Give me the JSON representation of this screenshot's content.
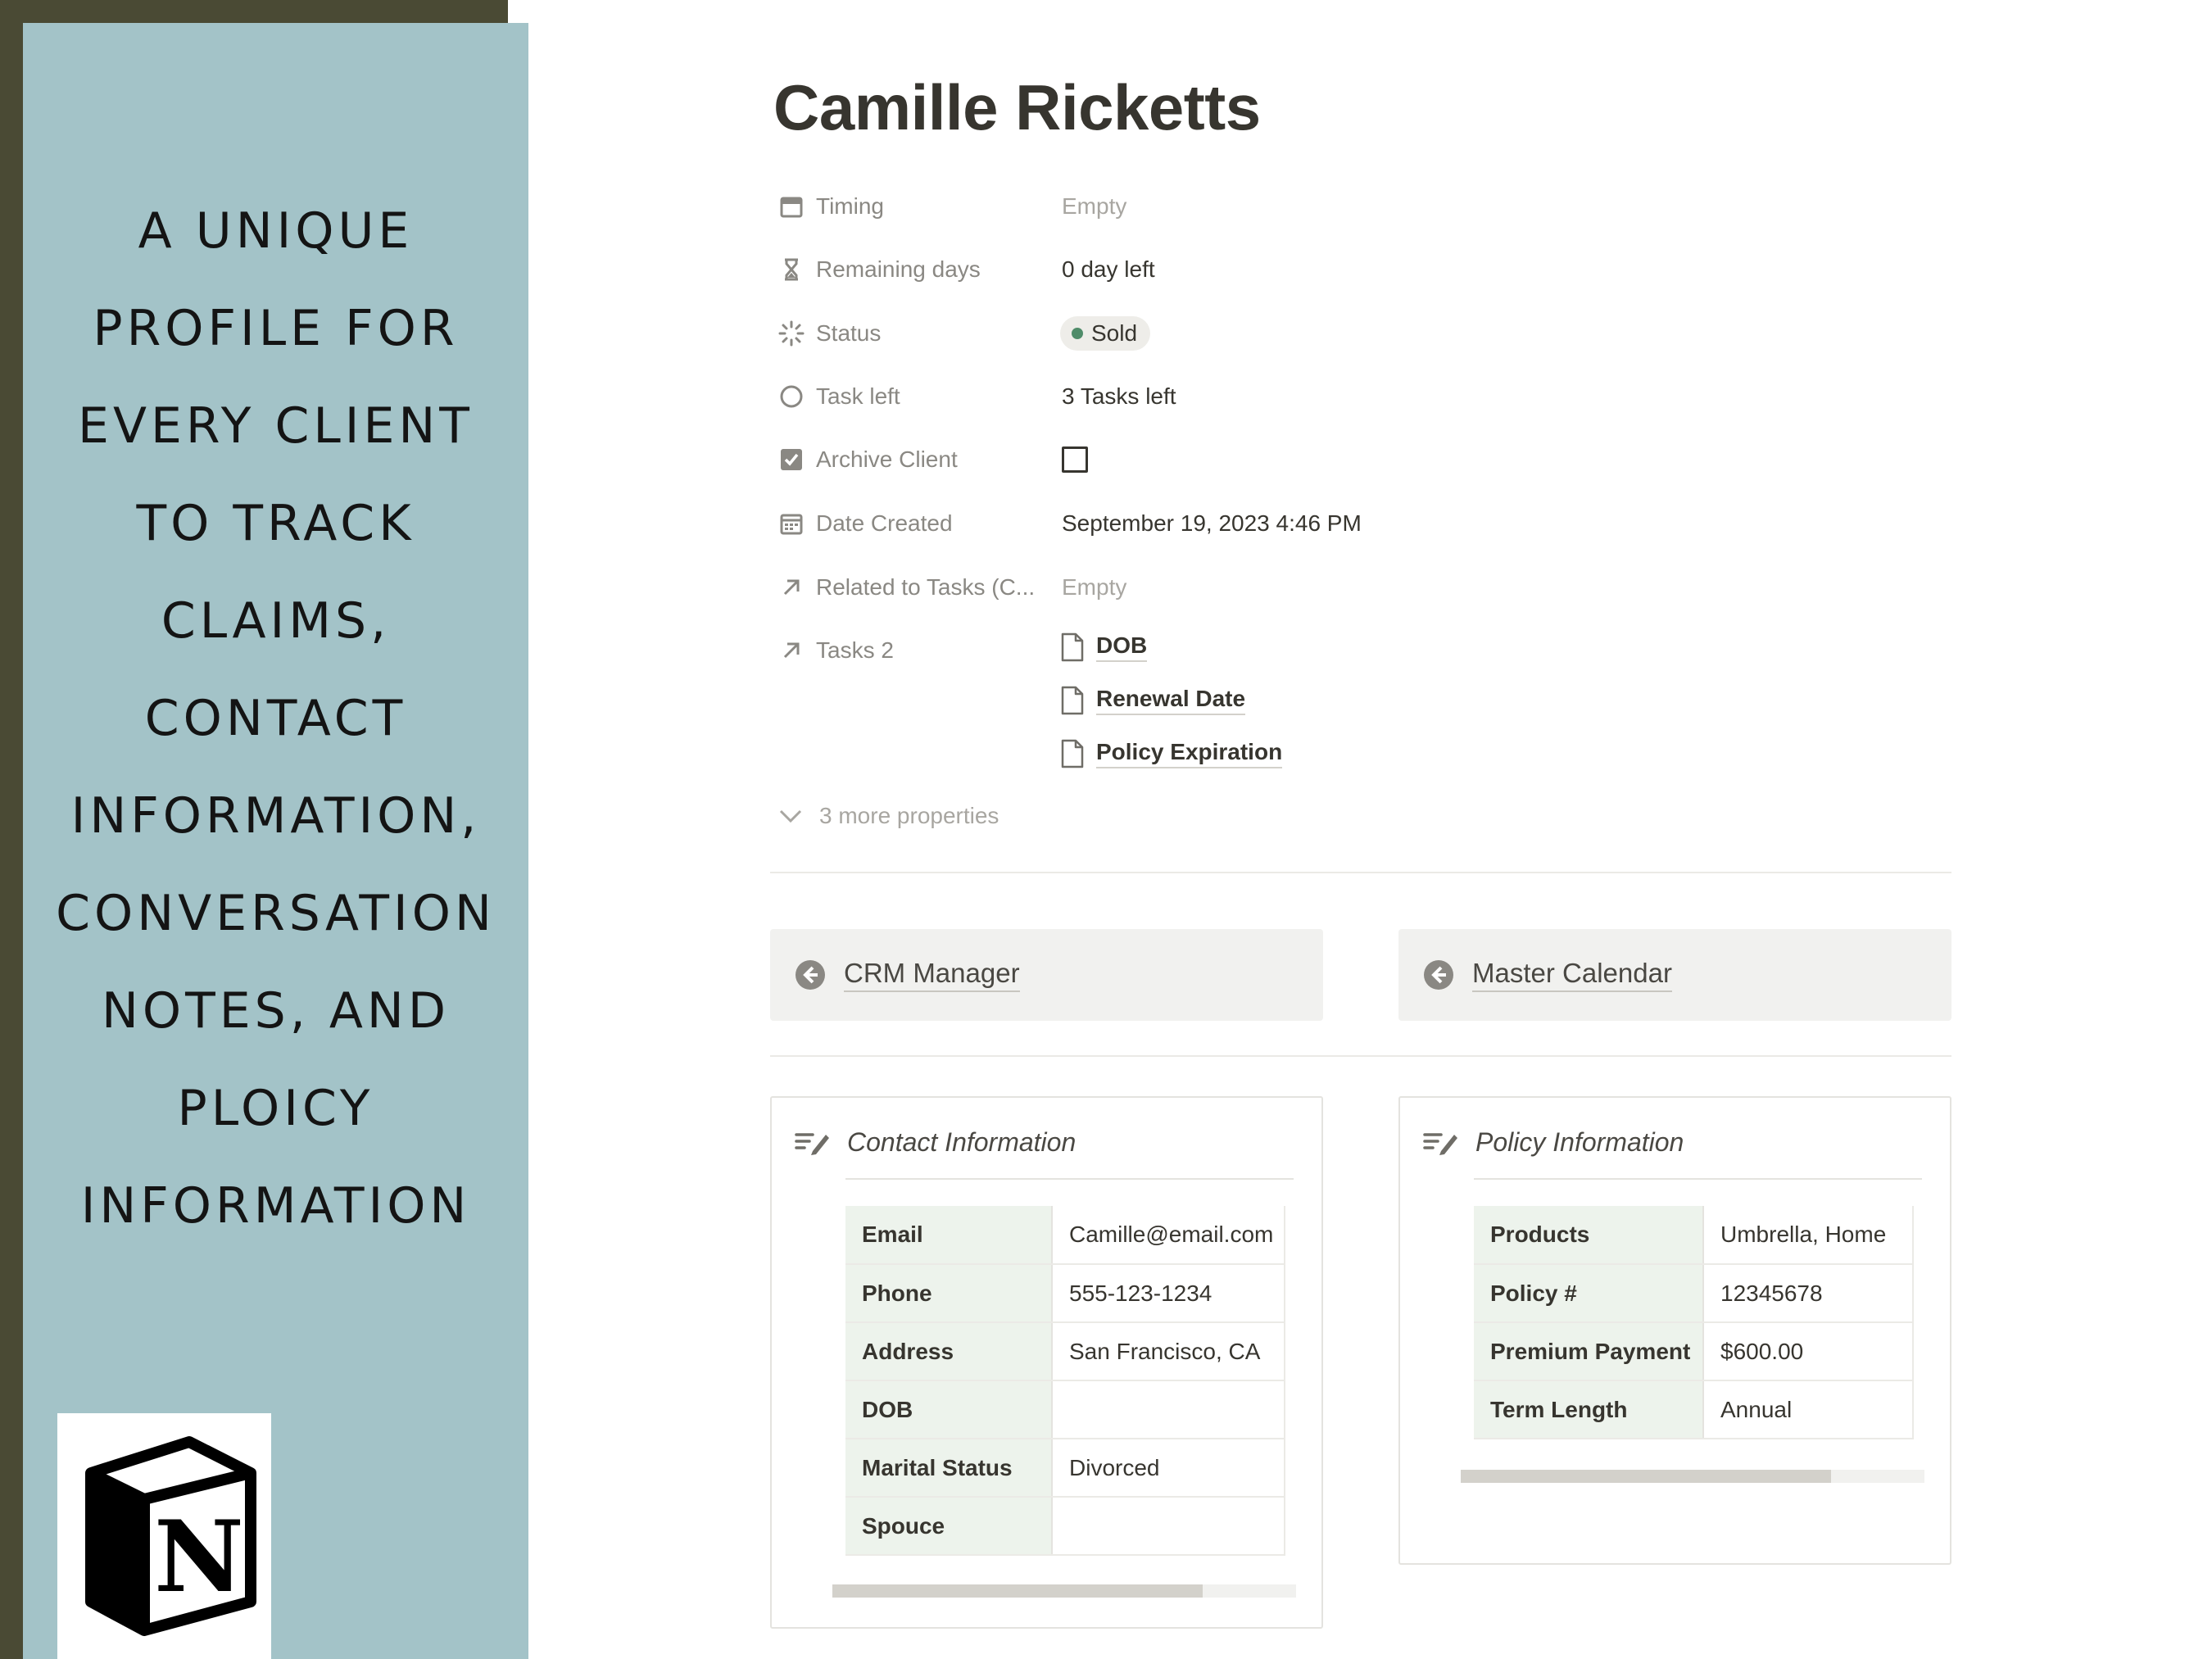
{
  "promo": {
    "lines": [
      "A UNIQUE",
      "PROFILE FOR",
      "EVERY CLIENT",
      "TO TRACK",
      "CLAIMS,",
      "CONTACT",
      "INFORMATION,",
      "CONVERSATION",
      "NOTES, AND",
      "PLOICY",
      "INFORMATION"
    ],
    "logo_letter": "N",
    "frame_color": "#4a4a34",
    "panel_color": "#a3c3c8"
  },
  "page": {
    "title": "Camille Ricketts"
  },
  "properties": {
    "timing": {
      "label": "Timing",
      "value": "Empty",
      "icon": "calendar-icon"
    },
    "remaining_days": {
      "label": "Remaining days",
      "value": "0 day left",
      "icon": "hourglass-icon"
    },
    "status": {
      "label": "Status",
      "value": "Sold",
      "icon": "status-icon",
      "color": "#4f8c69"
    },
    "task_left": {
      "label": "Task left",
      "value": "3 Tasks left",
      "icon": "circle-icon"
    },
    "archive_client": {
      "label": "Archive Client",
      "checked": false,
      "icon": "checkbox-icon"
    },
    "date_created": {
      "label": "Date Created",
      "value": "September 19, 2023 4:46 PM",
      "icon": "calendar-icon"
    },
    "related_tasks": {
      "label": "Related to Tasks (C...",
      "value": "Empty",
      "icon": "arrow-up-right-icon"
    },
    "tasks2": {
      "label": "Tasks 2",
      "icon": "arrow-up-right-icon",
      "items": [
        "DOB",
        "Renewal Date",
        "Policy Expiration"
      ]
    },
    "more": "3 more properties"
  },
  "nav_buttons": [
    {
      "label": "CRM Manager",
      "icon": "arrow-left-circle-icon"
    },
    {
      "label": "Master Calendar",
      "icon": "arrow-left-circle-icon"
    }
  ],
  "contact_card": {
    "title": "Contact Information",
    "rows": [
      {
        "key": "Email",
        "value": "Camille@email.com"
      },
      {
        "key": "Phone",
        "value": "555-123-1234"
      },
      {
        "key": "Address",
        "value": "San Francisco, CA"
      },
      {
        "key": "DOB",
        "value": ""
      },
      {
        "key": "Marital Status",
        "value": "Divorced"
      },
      {
        "key": "Spouce",
        "value": ""
      }
    ]
  },
  "policy_card": {
    "title": "Policy Information",
    "rows": [
      {
        "key": "Products",
        "value": "Umbrella, Home"
      },
      {
        "key": "Policy #",
        "value": "12345678"
      },
      {
        "key": "Premium Payment",
        "value": "$600.00"
      },
      {
        "key": "Term Length",
        "value": "Annual"
      }
    ]
  }
}
